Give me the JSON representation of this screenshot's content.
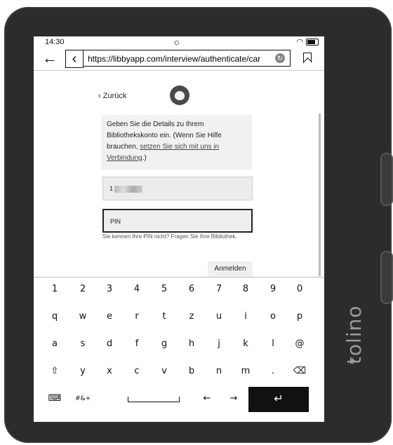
{
  "status": {
    "time": "14:30",
    "sun_icon": "brightness-icon",
    "wifi_icon": "wifi-icon",
    "battery_icon": "battery-icon"
  },
  "browser": {
    "url": "https://libbyapp.com/interview/authenticate/car"
  },
  "page": {
    "back_label": "Zurück",
    "info_text_before": "Geben Sie die Details zu Ihrem Bibliothekskonto ein. (Wenn Sie Hilfe brauchen, ",
    "info_link": "setzen Sie sich mit uns in Verbindung",
    "info_text_after": ".)",
    "card_prefix": "1",
    "pin_placeholder": "PIN",
    "hint": "Sie kennen Ihre PIN nicht? Fragen Sie Ihre Bibliothek.",
    "login_label": "Anmelden"
  },
  "keyboard": {
    "row1": [
      "1",
      "2",
      "3",
      "4",
      "5",
      "6",
      "7",
      "8",
      "9",
      "0"
    ],
    "row2": [
      "q",
      "w",
      "e",
      "r",
      "t",
      "z",
      "u",
      "i",
      "o",
      "p"
    ],
    "row3": [
      "a",
      "s",
      "d",
      "f",
      "g",
      "h",
      "j",
      "k",
      "l",
      "@"
    ],
    "row4": [
      "⇧",
      "y",
      "x",
      "c",
      "v",
      "b",
      "n",
      "m",
      ".",
      "⌫"
    ],
    "symbols_label": "#&+",
    "left_arrow": "←",
    "right_arrow": "→",
    "enter_label": "↵",
    "keyboard_icon": "⌨"
  },
  "device": {
    "brand": "tolino"
  }
}
